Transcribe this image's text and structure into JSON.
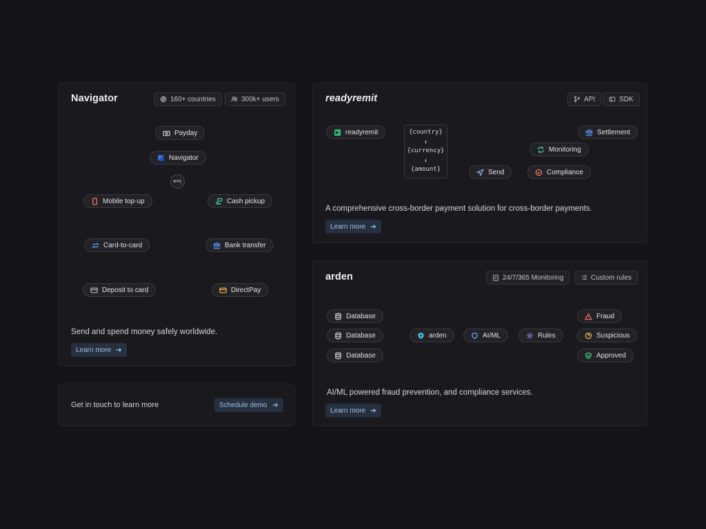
{
  "navigator": {
    "title": "Navigator",
    "badges": {
      "countries": "160+ countries",
      "users": "300k+ users"
    },
    "nodes": {
      "payday": "Payday",
      "navigator": "Navigator",
      "kyc": "KYC",
      "mobile_topup": "Mobile top-up",
      "cash_pickup": "Cash pickup",
      "card_to_card": "Card-to-card",
      "bank_transfer": "Bank transfer",
      "deposit_to_card": "Deposit to card",
      "directpay": "DirectPay"
    },
    "description": "Send and spend money safely worldwide.",
    "cta": "Learn more"
  },
  "contact": {
    "text": "Get in touch to learn more",
    "cta": "Schedule demo"
  },
  "readyremit": {
    "title": "readyremit",
    "badges": {
      "api": "API",
      "sdk": "SDK"
    },
    "nodes": {
      "readyremit": "readyremit",
      "send": "Send",
      "compliance": "Compliance",
      "monitoring": "Monitoring",
      "settlement": "Settlement"
    },
    "code": {
      "line1": "{country}",
      "arrow": "↓",
      "line2": "{currency}",
      "line3": "{amount}"
    },
    "description": "A comprehensive cross-border payment solution for cross-border payments.",
    "cta": "Learn more"
  },
  "arden": {
    "title": "arden",
    "badges": {
      "monitoring": "24/7/365 Monitoring",
      "rules": "Custom rules"
    },
    "nodes": {
      "database1": "Database",
      "database2": "Database",
      "database3": "Database",
      "arden": "arden",
      "aiml": "AI/ML",
      "rules": "Rules",
      "fraud": "Fraud",
      "suspicious": "Suspicious",
      "approved": "Approved"
    },
    "description": "AI/ML powered fraud prevention, and compliance services.",
    "cta": "Learn more"
  },
  "colors": {
    "background": "#141317",
    "card": "#1a191d",
    "accent_blue": "#9fc0ee",
    "green": "#3ecf8e",
    "red": "#f06a5a",
    "amber": "#e5b04a"
  }
}
